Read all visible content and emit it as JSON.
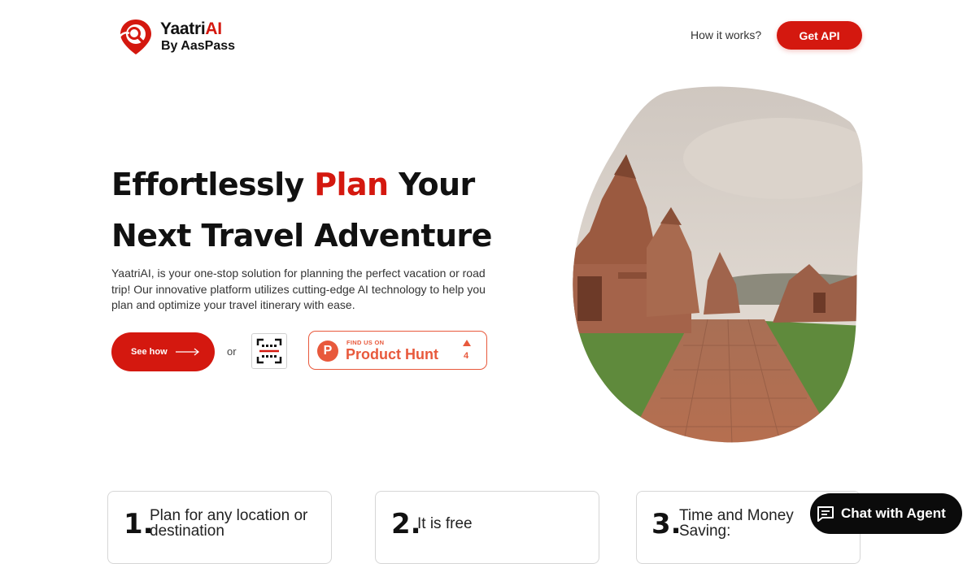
{
  "brand": {
    "name_main": "Yaatri",
    "name_accent": "AI",
    "subtitle": "By AasPass",
    "accent_color": "#d4180f",
    "logo_icon": "map-pin-search-icon"
  },
  "nav": {
    "how_it_works": "How it works?",
    "get_api": "Get API"
  },
  "hero": {
    "title_part1": "Effortlessly ",
    "title_accent": "Plan",
    "title_part2": " Your",
    "title_line2": "Next Travel Adventure",
    "description": "YaatriAI, is your one-stop solution for planning the perfect vacation or road trip! Our innovative platform utilizes cutting-edge AI technology to help you plan and optimize your travel itinerary with ease.",
    "see_how_label": "See how",
    "or_text": "or",
    "qr_icon": "qr-scan-icon",
    "image_subject": "ancient stone temples with brick pathway"
  },
  "product_hunt": {
    "small_label": "FIND US ON",
    "name": "Product Hunt",
    "logo_letter": "P",
    "upvotes": "4",
    "color": "#e8593c"
  },
  "steps": [
    {
      "number": "1.",
      "text_line1": "Plan for any location or",
      "text_line2": "destination"
    },
    {
      "number": "2.",
      "text_line1": "It is free",
      "text_line2": ""
    },
    {
      "number": "3.",
      "text_line1": "Time and Money",
      "text_line2": "Saving:"
    }
  ],
  "chat": {
    "label": "Chat with Agent",
    "icon": "chat-message-icon"
  }
}
